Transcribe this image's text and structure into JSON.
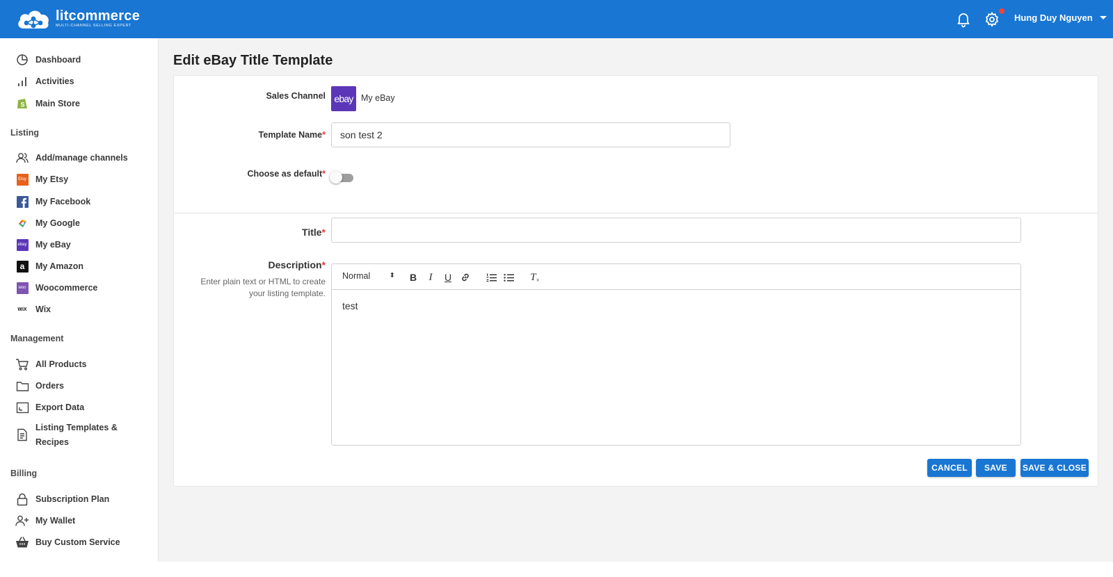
{
  "brand": {
    "name": "litcommerce",
    "tagline": "MULTI-CHANNEL SELLING EXPERT"
  },
  "topbar": {
    "user_name": "Hung Duy Nguyen",
    "icons": [
      "bell-icon",
      "gear-icon"
    ],
    "color": "#1976d2"
  },
  "sidebar": {
    "top_items": [
      {
        "label": "Dashboard",
        "icon": "pie-chart-icon"
      },
      {
        "label": "Activities",
        "icon": "bar-chart-icon"
      },
      {
        "label": "Main Store",
        "icon": "shopify-icon"
      }
    ],
    "listing": {
      "heading": "Listing",
      "items": [
        {
          "label": "Add/manage channels",
          "icon": "users-icon"
        },
        {
          "label": "My Etsy",
          "icon": "etsy-icon"
        },
        {
          "label": "My Facebook",
          "icon": "facebook-icon"
        },
        {
          "label": "My Google",
          "icon": "google-icon"
        },
        {
          "label": "My eBay",
          "icon": "ebay-icon"
        },
        {
          "label": "My Amazon",
          "icon": "amazon-icon"
        },
        {
          "label": "Woocommerce",
          "icon": "woocommerce-icon"
        },
        {
          "label": "Wix",
          "icon": "wix-icon"
        }
      ]
    },
    "management": {
      "heading": "Management",
      "items": [
        {
          "label": "All Products",
          "icon": "cart-icon"
        },
        {
          "label": "Orders",
          "icon": "folder-icon"
        },
        {
          "label": "Export Data",
          "icon": "export-icon"
        },
        {
          "label": "Listing Templates &",
          "label2": "Recipes",
          "icon": "document-icon"
        }
      ]
    },
    "billing": {
      "heading": "Billing",
      "items": [
        {
          "label": "Subscription Plan",
          "icon": "lock-icon"
        },
        {
          "label": "My Wallet",
          "icon": "user-plus-icon"
        },
        {
          "label": "Buy Custom Service",
          "icon": "basket-icon"
        }
      ]
    },
    "icon_badges": {
      "etsy": "Etsy",
      "ebay": "ebay",
      "amazon": "a",
      "woo": "woo",
      "wix": "WiX"
    }
  },
  "page": {
    "title": "Edit eBay Title Template"
  },
  "form": {
    "sales_channel_label": "Sales Channel",
    "channel_badge": "ebay",
    "channel_name": "My eBay",
    "template_name_label": "Template Name",
    "template_name_value": "son test 2",
    "default_label": "Choose as default",
    "default_on": false,
    "title_label": "Title",
    "title_value": "",
    "description_label": "Description",
    "description_help": "Enter plain text or HTML to create your listing template.",
    "required_mark": "*",
    "editor": {
      "format_value": "Normal",
      "format_arrow": "⬍",
      "tools": [
        "bold-icon",
        "italic-icon",
        "underline-icon",
        "link-icon",
        "ordered-list-icon",
        "bullet-list-icon",
        "clear-format-icon"
      ],
      "glyphs": {
        "bold": "B",
        "italic": "I",
        "underline": "U",
        "clear": "T"
      },
      "content": "test"
    }
  },
  "actions": {
    "cancel": "CANCEL",
    "save": "SAVE",
    "save_close": "SAVE & CLOSE"
  }
}
